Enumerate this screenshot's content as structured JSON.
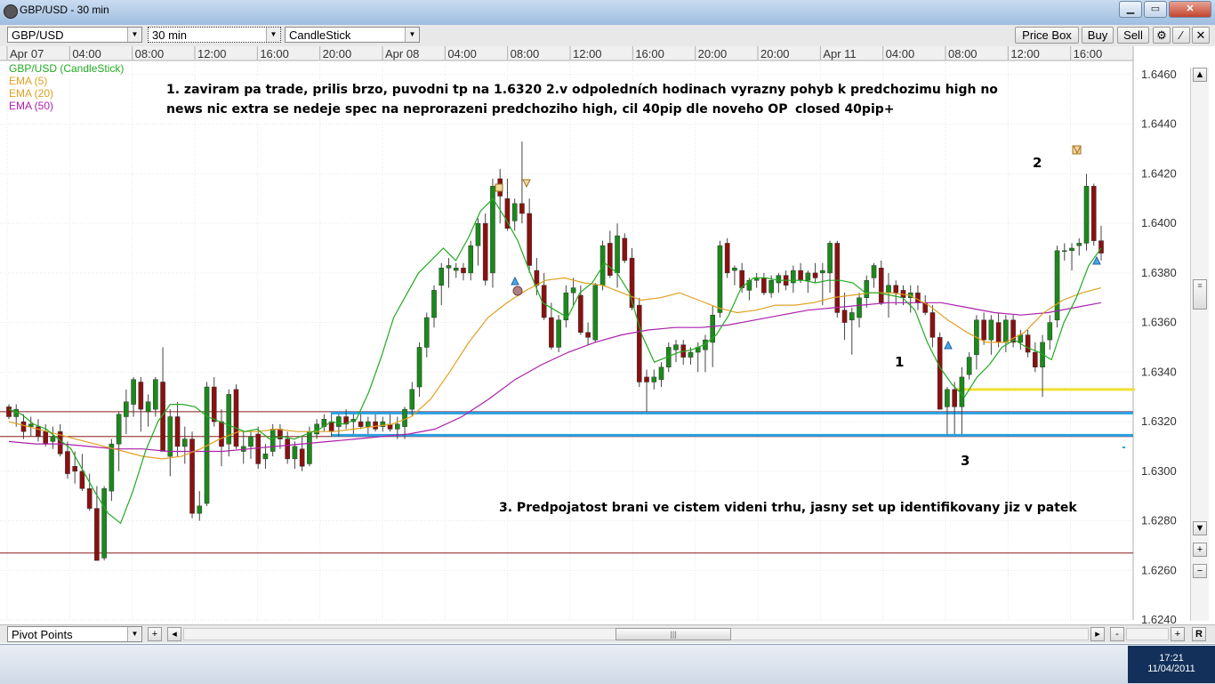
{
  "window": {
    "title": "GBP/USD - 30 min"
  },
  "toolbar": {
    "instrument": "GBP/USD",
    "timeframe": "30 min",
    "chart_type": "CandleStick",
    "price_box": "Price Box",
    "buy": "Buy",
    "sell": "Sell"
  },
  "bottom": {
    "indicator": "Pivot Points",
    "plus": "+",
    "minus": "-",
    "reset": "R"
  },
  "clock": {
    "time": "17:21",
    "date": "11/04/2011"
  },
  "colors": {
    "up": "#1a8a1a",
    "down": "#8b1010",
    "ema5": "#22aa22",
    "ema20": "#e0a020",
    "ema50": "#aa20aa",
    "blue_line": "#2aa0e0",
    "yellow_line": "#f0e030",
    "pivot": "#8b1a1a"
  },
  "chart_data": {
    "type": "candlestick",
    "instrument": "GBP/USD",
    "timeframe": "30 min",
    "legend": [
      "GBP/USD (CandleStick)",
      "EMA (5)",
      "EMA (20)",
      "EMA (50)"
    ],
    "x_labels": [
      "Apr 07",
      "04:00",
      "08:00",
      "12:00",
      "16:00",
      "20:00",
      "Apr 08",
      "04:00",
      "08:00",
      "12:00",
      "16:00",
      "20:00",
      "20:00",
      "Apr 11",
      "04:00",
      "08:00",
      "12:00",
      "16:00"
    ],
    "y_ticks": [
      "1.6460",
      "1.6440",
      "1.6420",
      "1.6400",
      "1.6380",
      "1.6360",
      "1.6340",
      "1.6320",
      "1.6300",
      "1.6280",
      "1.6260",
      "1.6240"
    ],
    "ylim": [
      1.624,
      1.6465
    ],
    "candles": [
      [
        1.6326,
        1.6327,
        1.6321,
        1.6322
      ],
      [
        1.6322,
        1.6327,
        1.6318,
        1.6325
      ],
      [
        1.632,
        1.6323,
        1.6313,
        1.6316
      ],
      [
        1.6318,
        1.6322,
        1.6314,
        1.6319
      ],
      [
        1.6318,
        1.6321,
        1.6312,
        1.6314
      ],
      [
        1.6316,
        1.6319,
        1.631,
        1.6311
      ],
      [
        1.6312,
        1.6318,
        1.6309,
        1.6314
      ],
      [
        1.6316,
        1.6319,
        1.6306,
        1.6307
      ],
      [
        1.6308,
        1.6312,
        1.6297,
        1.6299
      ],
      [
        1.6302,
        1.6308,
        1.6295,
        1.63
      ],
      [
        1.63,
        1.6307,
        1.6292,
        1.6293
      ],
      [
        1.6293,
        1.6299,
        1.6284,
        1.6285
      ],
      [
        1.6285,
        1.6294,
        1.6264,
        1.6264
      ],
      [
        1.6265,
        1.6294,
        1.6264,
        1.6293
      ],
      [
        1.6292,
        1.6313,
        1.6288,
        1.6311
      ],
      [
        1.6311,
        1.6324,
        1.63,
        1.6323
      ],
      [
        1.6322,
        1.6333,
        1.6315,
        1.6328
      ],
      [
        1.6327,
        1.6338,
        1.6322,
        1.6337
      ],
      [
        1.6336,
        1.6338,
        1.6316,
        1.6325
      ],
      [
        1.6324,
        1.6331,
        1.6318,
        1.6328
      ],
      [
        1.6325,
        1.6338,
        1.6322,
        1.6337
      ],
      [
        1.6336,
        1.635,
        1.6315,
        1.6308
      ],
      [
        1.6306,
        1.6325,
        1.6298,
        1.6322
      ],
      [
        1.6322,
        1.6328,
        1.6306,
        1.631
      ],
      [
        1.631,
        1.6318,
        1.6303,
        1.6313
      ],
      [
        1.6313,
        1.6316,
        1.6281,
        1.6283
      ],
      [
        1.6283,
        1.6292,
        1.628,
        1.6286
      ],
      [
        1.6287,
        1.6336,
        1.6286,
        1.6334
      ],
      [
        1.6334,
        1.6338,
        1.6318,
        1.632
      ],
      [
        1.632,
        1.6325,
        1.6302,
        1.631
      ],
      [
        1.6311,
        1.6333,
        1.6306,
        1.6331
      ],
      [
        1.6333,
        1.6335,
        1.6309,
        1.631
      ],
      [
        1.6308,
        1.6316,
        1.6303,
        1.631
      ],
      [
        1.631,
        1.6316,
        1.6305,
        1.6314
      ],
      [
        1.6315,
        1.6318,
        1.6301,
        1.6303
      ],
      [
        1.6305,
        1.6311,
        1.6301,
        1.6307
      ],
      [
        1.6308,
        1.6319,
        1.6306,
        1.6317
      ],
      [
        1.6317,
        1.6319,
        1.6309,
        1.6313
      ],
      [
        1.6313,
        1.6316,
        1.6303,
        1.6305
      ],
      [
        1.6305,
        1.6312,
        1.6301,
        1.631
      ],
      [
        1.6309,
        1.6314,
        1.63,
        1.6302
      ],
      [
        1.6303,
        1.6318,
        1.6302,
        1.6316
      ],
      [
        1.6315,
        1.6321,
        1.6313,
        1.6319
      ],
      [
        1.6318,
        1.6323,
        1.6316,
        1.6321
      ],
      [
        1.632,
        1.6323,
        1.6314,
        1.6316
      ],
      [
        1.6318,
        1.6323,
        1.6314,
        1.6322
      ],
      [
        1.6322,
        1.6325,
        1.6317,
        1.6319
      ],
      [
        1.632,
        1.6323,
        1.6315,
        1.6321
      ],
      [
        1.632,
        1.6323,
        1.6317,
        1.6318
      ],
      [
        1.6318,
        1.6322,
        1.6315,
        1.632
      ],
      [
        1.632,
        1.6323,
        1.6316,
        1.6317
      ],
      [
        1.6318,
        1.6322,
        1.6316,
        1.632
      ],
      [
        1.6319,
        1.6323,
        1.6316,
        1.6317
      ],
      [
        1.6317,
        1.6322,
        1.6313,
        1.6319
      ],
      [
        1.6318,
        1.6326,
        1.6313,
        1.6325
      ],
      [
        1.6325,
        1.6336,
        1.6322,
        1.6333
      ],
      [
        1.6334,
        1.6352,
        1.633,
        1.635
      ],
      [
        1.635,
        1.6364,
        1.6346,
        1.6362
      ],
      [
        1.6362,
        1.6375,
        1.6358,
        1.6373
      ],
      [
        1.6375,
        1.6384,
        1.6367,
        1.6382
      ],
      [
        1.6382,
        1.6386,
        1.6374,
        1.6383
      ],
      [
        1.6381,
        1.6384,
        1.6378,
        1.6382
      ],
      [
        1.6382,
        1.6384,
        1.6377,
        1.638
      ],
      [
        1.638,
        1.6393,
        1.6377,
        1.6391
      ],
      [
        1.6391,
        1.6402,
        1.6383,
        1.64
      ],
      [
        1.64,
        1.6404,
        1.6375,
        1.6377
      ],
      [
        1.638,
        1.6418,
        1.6374,
        1.6415
      ],
      [
        1.6418,
        1.6422,
        1.64,
        1.6411
      ],
      [
        1.641,
        1.6418,
        1.6397,
        1.6398
      ],
      [
        1.6401,
        1.641,
        1.6397,
        1.6408
      ],
      [
        1.6408,
        1.6433,
        1.64,
        1.6404
      ],
      [
        1.6404,
        1.641,
        1.638,
        1.6383
      ],
      [
        1.6381,
        1.6386,
        1.6371,
        1.6375
      ],
      [
        1.6375,
        1.638,
        1.6361,
        1.6362
      ],
      [
        1.6362,
        1.6368,
        1.6349,
        1.635
      ],
      [
        1.635,
        1.6363,
        1.6348,
        1.6361
      ],
      [
        1.6361,
        1.6375,
        1.6358,
        1.6372
      ],
      [
        1.6372,
        1.6378,
        1.6367,
        1.6374
      ],
      [
        1.6371,
        1.6375,
        1.6355,
        1.6356
      ],
      [
        1.6356,
        1.636,
        1.6351,
        1.6354
      ],
      [
        1.6353,
        1.6376,
        1.6352,
        1.6375
      ],
      [
        1.6375,
        1.6393,
        1.6373,
        1.6391
      ],
      [
        1.6392,
        1.6397,
        1.6378,
        1.6379
      ],
      [
        1.638,
        1.64,
        1.6374,
        1.6395
      ],
      [
        1.6394,
        1.6396,
        1.6384,
        1.6385
      ],
      [
        1.6386,
        1.639,
        1.6365,
        1.6366
      ],
      [
        1.6367,
        1.637,
        1.6334,
        1.6336
      ],
      [
        1.6338,
        1.6341,
        1.6324,
        1.6336
      ],
      [
        1.6336,
        1.6341,
        1.6333,
        1.6338
      ],
      [
        1.6337,
        1.6344,
        1.6334,
        1.6342
      ],
      [
        1.6342,
        1.6352,
        1.634,
        1.635
      ],
      [
        1.6349,
        1.6353,
        1.6344,
        1.6351
      ],
      [
        1.6351,
        1.6353,
        1.6343,
        1.6346
      ],
      [
        1.6346,
        1.635,
        1.6343,
        1.6348
      ],
      [
        1.6348,
        1.6352,
        1.634,
        1.635
      ],
      [
        1.6349,
        1.6355,
        1.634,
        1.6353
      ],
      [
        1.6352,
        1.6367,
        1.6342,
        1.6363
      ],
      [
        1.6364,
        1.6393,
        1.6362,
        1.6391
      ],
      [
        1.6392,
        1.6394,
        1.6378,
        1.638
      ],
      [
        1.6381,
        1.6383,
        1.6375,
        1.6382
      ],
      [
        1.6381,
        1.6384,
        1.6372,
        1.6374
      ],
      [
        1.6373,
        1.6378,
        1.6369,
        1.6377
      ],
      [
        1.6377,
        1.638,
        1.6374,
        1.6378
      ],
      [
        1.6378,
        1.638,
        1.6371,
        1.6372
      ],
      [
        1.6372,
        1.6379,
        1.637,
        1.6377
      ],
      [
        1.6376,
        1.638,
        1.6372,
        1.6379
      ],
      [
        1.6379,
        1.6381,
        1.6373,
        1.6375
      ],
      [
        1.6376,
        1.6383,
        1.6372,
        1.6381
      ],
      [
        1.6381,
        1.6384,
        1.6376,
        1.6377
      ],
      [
        1.6377,
        1.6381,
        1.6372,
        1.638
      ],
      [
        1.638,
        1.6384,
        1.6376,
        1.6378
      ],
      [
        1.638,
        1.6384,
        1.6367,
        1.6381
      ],
      [
        1.638,
        1.6393,
        1.6372,
        1.6392
      ],
      [
        1.6392,
        1.6393,
        1.6362,
        1.6364
      ],
      [
        1.6365,
        1.6372,
        1.6353,
        1.636
      ],
      [
        1.6361,
        1.6366,
        1.6347,
        1.6364
      ],
      [
        1.6362,
        1.6372,
        1.6358,
        1.637
      ],
      [
        1.637,
        1.6379,
        1.6366,
        1.6377
      ],
      [
        1.6378,
        1.6384,
        1.6374,
        1.6383
      ],
      [
        1.6382,
        1.6385,
        1.6367,
        1.6368
      ],
      [
        1.6372,
        1.638,
        1.6362,
        1.6375
      ],
      [
        1.6375,
        1.6377,
        1.6367,
        1.6372
      ],
      [
        1.6373,
        1.6375,
        1.6367,
        1.637
      ],
      [
        1.637,
        1.6375,
        1.6364,
        1.6372
      ],
      [
        1.6372,
        1.6375,
        1.6365,
        1.6368
      ],
      [
        1.6368,
        1.6371,
        1.6363,
        1.6364
      ],
      [
        1.6364,
        1.6367,
        1.635,
        1.6354
      ],
      [
        1.6354,
        1.6356,
        1.6325,
        1.6325
      ],
      [
        1.6326,
        1.6334,
        1.6315,
        1.6333
      ],
      [
        1.6333,
        1.6336,
        1.6315,
        1.6326
      ],
      [
        1.6326,
        1.6342,
        1.6315,
        1.6338
      ],
      [
        1.6339,
        1.6348,
        1.6337,
        1.6346
      ],
      [
        1.6347,
        1.6363,
        1.6341,
        1.6361
      ],
      [
        1.6361,
        1.6364,
        1.6351,
        1.6353
      ],
      [
        1.6353,
        1.6363,
        1.6347,
        1.6361
      ],
      [
        1.636,
        1.6364,
        1.635,
        1.6352
      ],
      [
        1.6352,
        1.6363,
        1.6348,
        1.6361
      ],
      [
        1.6361,
        1.6363,
        1.635,
        1.6352
      ],
      [
        1.6352,
        1.6357,
        1.6349,
        1.6355
      ],
      [
        1.6355,
        1.6357,
        1.6346,
        1.6348
      ],
      [
        1.6348,
        1.6352,
        1.634,
        1.6342
      ],
      [
        1.6342,
        1.6355,
        1.633,
        1.6352
      ],
      [
        1.6353,
        1.6363,
        1.6349,
        1.636
      ],
      [
        1.6361,
        1.6391,
        1.6358,
        1.6389
      ],
      [
        1.6389,
        1.6392,
        1.6385,
        1.6389
      ],
      [
        1.6389,
        1.6392,
        1.6381,
        1.639
      ],
      [
        1.6391,
        1.6394,
        1.6387,
        1.6392
      ],
      [
        1.6392,
        1.642,
        1.6389,
        1.6415
      ],
      [
        1.6415,
        1.6416,
        1.6391,
        1.6393
      ],
      [
        1.6393,
        1.6399,
        1.6385,
        1.6388
      ]
    ],
    "ema5": [
      1.6325,
      1.6323,
      1.6319,
      1.6317,
      1.6313,
      1.6309,
      1.63,
      1.6291,
      1.6283,
      1.6279,
      1.6292,
      1.6308,
      1.632,
      1.6327,
      1.6327,
      1.6326,
      1.6322,
      1.632,
      1.6318,
      1.6316,
      1.6317,
      1.6313,
      1.6314,
      1.6313,
      1.6315,
      1.6317,
      1.632,
      1.6319,
      1.6321,
      1.6332,
      1.6346,
      1.6362,
      1.6371,
      1.638,
      1.6385,
      1.639,
      1.6385,
      1.6394,
      1.6405,
      1.641,
      1.6402,
      1.6393,
      1.638,
      1.6368,
      1.6365,
      1.6362,
      1.6372,
      1.6376,
      1.6384,
      1.638,
      1.6372,
      1.6355,
      1.6344,
      1.6346,
      1.6348,
      1.6349,
      1.6351,
      1.6355,
      1.6363,
      1.6374,
      1.6378,
      1.6378,
      1.6377,
      1.6377,
      1.6377,
      1.6376,
      1.6377,
      1.6377,
      1.6376,
      1.6372,
      1.6372,
      1.6371,
      1.637,
      1.6365,
      1.6352,
      1.6342,
      1.6335,
      1.633,
      1.6338,
      1.6343,
      1.635,
      1.6353,
      1.635,
      1.6348,
      1.6345,
      1.636,
      1.637,
      1.6383,
      1.639
    ],
    "ema20": [
      1.632,
      1.6318,
      1.6316,
      1.6314,
      1.6312,
      1.631,
      1.6308,
      1.6306,
      1.6305,
      1.6306,
      1.6309,
      1.6313,
      1.6316,
      1.6316,
      1.6317,
      1.6316,
      1.6316,
      1.6316,
      1.6317,
      1.6318,
      1.6319,
      1.6322,
      1.6329,
      1.634,
      1.6352,
      1.6362,
      1.6368,
      1.6373,
      1.6377,
      1.6378,
      1.6376,
      1.6375,
      1.6372,
      1.6369,
      1.637,
      1.6372,
      1.6369,
      1.6366,
      1.6364,
      1.6365,
      1.6367,
      1.6367,
      1.6368,
      1.637,
      1.6371,
      1.6372,
      1.6372,
      1.6371,
      1.6367,
      1.6361,
      1.6356,
      1.6352,
      1.6352,
      1.6356,
      1.6364,
      1.6369,
      1.6372,
      1.6374
    ],
    "ema50": [
      1.6312,
      1.6311,
      1.6311,
      1.631,
      1.6309,
      1.6309,
      1.6308,
      1.6308,
      1.6308,
      1.6309,
      1.631,
      1.6311,
      1.6312,
      1.6313,
      1.6314,
      1.6315,
      1.6317,
      1.6322,
      1.6329,
      1.6337,
      1.6343,
      1.6348,
      1.6352,
      1.6355,
      1.6357,
      1.6358,
      1.6358,
      1.6359,
      1.6361,
      1.6363,
      1.6365,
      1.6366,
      1.6367,
      1.6368,
      1.6368,
      1.6368,
      1.6366,
      1.6364,
      1.6363,
      1.6364,
      1.6366,
      1.6368
    ],
    "levels": [
      {
        "name": "pivot-upper",
        "price": 1.6324,
        "color": "#8b1a1a"
      },
      {
        "name": "pivot-mid",
        "price": 1.6314,
        "color": "#8b1a1a"
      },
      {
        "name": "pivot-low",
        "price": 1.6267,
        "color": "#8b1a1a"
      },
      {
        "name": "blue-upper",
        "price": 1.63235,
        "color": "#2aa0e0"
      },
      {
        "name": "blue-lower",
        "price": 1.63145,
        "color": "#2aa0e0"
      },
      {
        "name": "yellow",
        "price": 1.6333,
        "color": "#f0e030"
      }
    ],
    "annotations": {
      "note1": "1. zaviram pa trade, prilis brzo, puvodni tp na 1.6320 2.v odpoledních hodinach vyrazny pohyb k predchozimu high no",
      "note1b": "news nic extra se nedeje spec na neprorazeni predchoziho high, cil 40pip dle noveho OP",
      "note1c": "closed 40pip+",
      "note3": "3. Predpojatost brani ve cistem videni trhu, jasny set up identifikovany jiz v patek",
      "label1": "1",
      "label2": "2",
      "label3": "3"
    }
  }
}
